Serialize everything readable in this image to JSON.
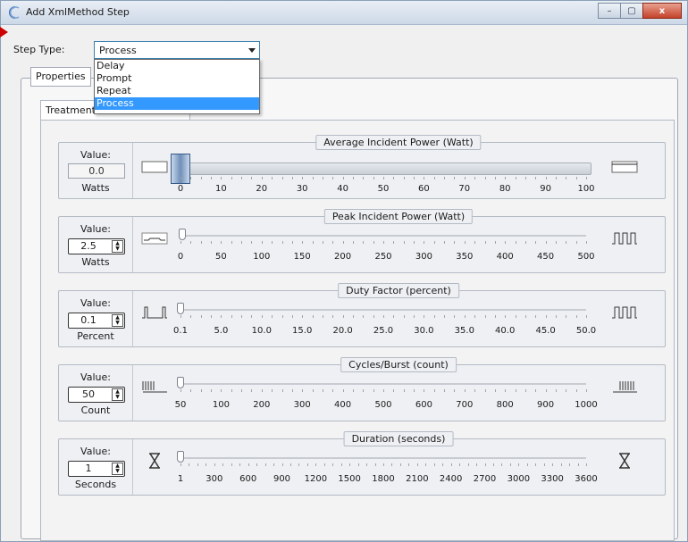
{
  "window": {
    "title": "Add XmlMethod Step",
    "minimize_glyph": "–",
    "maximize_glyph": "▢",
    "close_glyph": "x"
  },
  "step": {
    "label": "Step Type:",
    "selected": "Process",
    "options": [
      "Delay",
      "Prompt",
      "Repeat",
      "Process"
    ]
  },
  "tabs": {
    "properties": "Properties",
    "treatment": "Treatment"
  },
  "panels": [
    {
      "title": "Average Incident Power (Watt)",
      "value_label": "Value:",
      "value": "0.0",
      "unit": "Watts",
      "editable": false,
      "ticks": [
        "0",
        "10",
        "20",
        "30",
        "40",
        "50",
        "60",
        "70",
        "80",
        "90",
        "100"
      ],
      "level": 0,
      "left_icon": "empty-box-icon",
      "right_icon": "full-bar-icon"
    },
    {
      "title": "Peak Incident Power (Watt)",
      "value_label": "Value:",
      "value": "2.5",
      "unit": "Watts",
      "editable": true,
      "ticks": [
        "0",
        "50",
        "100",
        "150",
        "200",
        "250",
        "300",
        "350",
        "400",
        "450",
        "500"
      ],
      "level": 0.005,
      "left_icon": "low-pulse-icon",
      "right_icon": "high-pulse-icon"
    },
    {
      "title": "Duty Factor (percent)",
      "value_label": "Value:",
      "value": "0.1",
      "unit": "Percent",
      "editable": true,
      "ticks": [
        "0.1",
        "5.0",
        "10.0",
        "15.0",
        "20.0",
        "25.0",
        "30.0",
        "35.0",
        "40.0",
        "45.0",
        "50.0"
      ],
      "level": 0,
      "left_icon": "sparse-pulse-icon",
      "right_icon": "dense-pulse-icon"
    },
    {
      "title": "Cycles/Burst (count)",
      "value_label": "Value:",
      "value": "50",
      "unit": "Count",
      "editable": true,
      "ticks": [
        "50",
        "100",
        "200",
        "300",
        "400",
        "500",
        "600",
        "700",
        "800",
        "900",
        "1000"
      ],
      "level": 0,
      "left_icon": "short-burst-icon",
      "right_icon": "long-burst-icon"
    },
    {
      "title": "Duration (seconds)",
      "value_label": "Value:",
      "value": "1",
      "unit": "Seconds",
      "editable": true,
      "ticks": [
        "1",
        "300",
        "600",
        "900",
        "1200",
        "1500",
        "1800",
        "2100",
        "2400",
        "2700",
        "3000",
        "3300",
        "3600"
      ],
      "level": 0,
      "left_icon": "hourglass-icon",
      "right_icon": "hourglass-icon"
    }
  ]
}
